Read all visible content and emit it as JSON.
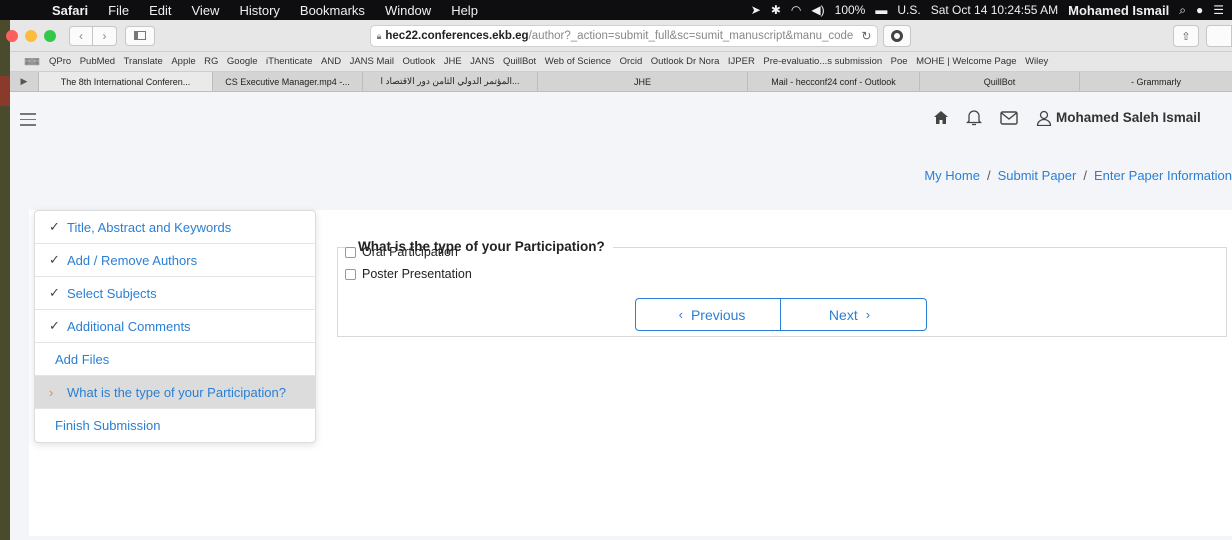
{
  "menubar": {
    "app": "Safari",
    "items": [
      "File",
      "Edit",
      "View",
      "History",
      "Bookmarks",
      "Window",
      "Help"
    ],
    "battery": "100%",
    "locale": "U.S.",
    "datetime": "Sat Oct 14  10:24:55 AM",
    "user": "Mohamed Ismail"
  },
  "toolbar": {
    "url_host": "hec22.conferences.ekb.eg",
    "url_path": "/author?_action=submit_full&sc=sumit_manuscript&manu_code"
  },
  "bookmarks": [
    "QPro",
    "PubMed",
    "Translate",
    "Apple",
    "RG",
    "Google",
    "iThenticate",
    "AND",
    "JANS Mail",
    "Outlook",
    "JHE",
    "JANS",
    "QuillBot",
    "Web of Science",
    "Orcid",
    "Outlook Dr Nora",
    "IJPER",
    "Pre-evaluatio...s submission",
    "Poe",
    "MOHE | Welcome Page",
    "Wiley"
  ],
  "tabs": [
    "The 8th International Conferen...",
    "CS Executive Manager.mp4 -...",
    "المؤتمر الدولي الثامن دور الاقتصاد ا...",
    "JHE",
    "Mail - hecconf24 conf - Outlook",
    "QuillBot",
    "- Grammarly"
  ],
  "header": {
    "user_name": "Mohamed Saleh Ismail"
  },
  "breadcrumb": {
    "home": "My Home",
    "submit": "Submit Paper",
    "current": "Enter Paper Information"
  },
  "steps": [
    {
      "label": "Title, Abstract and Keywords",
      "mark": "✓"
    },
    {
      "label": "Add / Remove Authors",
      "mark": "✓"
    },
    {
      "label": "Select Subjects",
      "mark": "✓"
    },
    {
      "label": "Additional Comments",
      "mark": "✓"
    },
    {
      "label": "Add Files",
      "mark": ""
    },
    {
      "label": "What is the type of your Participation?",
      "mark": "›"
    },
    {
      "label": "Finish Submission",
      "mark": ""
    }
  ],
  "participation": {
    "title": "What is the type of your Participation?",
    "options": [
      "Oral Participation",
      "Poster Presentation"
    ],
    "prev_label": "Previous",
    "next_label": "Next"
  }
}
